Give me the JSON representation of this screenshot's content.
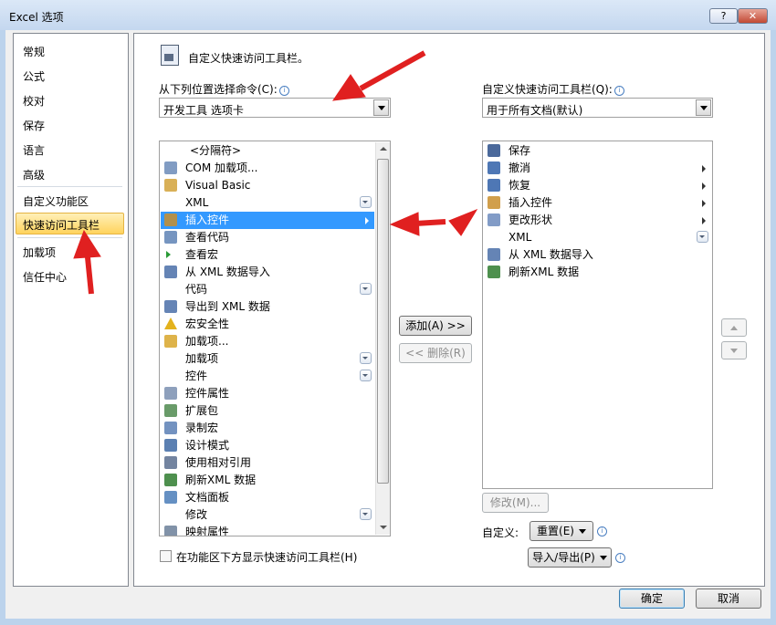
{
  "window": {
    "title": "Excel 选项",
    "help": "?",
    "close": "✕"
  },
  "nav": {
    "items": [
      "常规",
      "公式",
      "校对",
      "保存",
      "语言",
      "高级",
      "自定义功能区",
      "快速访问工具栏",
      "加载项",
      "信任中心"
    ],
    "selected": "快速访问工具栏"
  },
  "header": {
    "text": "自定义快速访问工具栏。"
  },
  "choose": {
    "label": "从下列位置选择命令(C):",
    "value": "开发工具 选项卡"
  },
  "customize": {
    "label": "自定义快速访问工具栏(Q):",
    "value": "用于所有文档(默认)"
  },
  "commands": [
    {
      "label": "<分隔符>",
      "icon": ""
    },
    {
      "label": "COM 加载项...",
      "icon": "com-addin-icon"
    },
    {
      "label": "Visual Basic",
      "icon": "visual-basic-icon"
    },
    {
      "label": "XML",
      "icon": "",
      "expand": true
    },
    {
      "label": "插入控件",
      "icon": "insert-control-icon",
      "submenu": true,
      "selected": true
    },
    {
      "label": "查看代码",
      "icon": "view-code-icon"
    },
    {
      "label": "查看宏",
      "icon": "play-icon"
    },
    {
      "label": "从 XML 数据导入",
      "icon": "xml-import-icon"
    },
    {
      "label": "代码",
      "icon": "",
      "expand": true
    },
    {
      "label": "导出到 XML 数据",
      "icon": "xml-export-icon"
    },
    {
      "label": "宏安全性",
      "icon": "warning-icon"
    },
    {
      "label": "加载项...",
      "icon": "addin-icon"
    },
    {
      "label": "加载项",
      "icon": "",
      "expand": true
    },
    {
      "label": "控件",
      "icon": "",
      "expand": true
    },
    {
      "label": "控件属性",
      "icon": "properties-icon"
    },
    {
      "label": "扩展包",
      "icon": "expansion-pack-icon"
    },
    {
      "label": "录制宏",
      "icon": "record-macro-icon"
    },
    {
      "label": "设计模式",
      "icon": "design-mode-icon"
    },
    {
      "label": "使用相对引用",
      "icon": "relative-ref-icon"
    },
    {
      "label": "刷新XML 数据",
      "icon": "refresh-xml-icon"
    },
    {
      "label": "文档面板",
      "icon": "document-panel-icon"
    },
    {
      "label": "修改",
      "icon": "",
      "expand": true
    },
    {
      "label": "映射属性",
      "icon": "map-properties-icon"
    }
  ],
  "toolbar_items": [
    {
      "label": "保存",
      "icon": "save-icon"
    },
    {
      "label": "撤消",
      "icon": "undo-icon",
      "submenu": true
    },
    {
      "label": "恢复",
      "icon": "redo-icon",
      "submenu": true
    },
    {
      "label": "插入控件",
      "icon": "insert-control-icon",
      "submenu": true
    },
    {
      "label": "更改形状",
      "icon": "change-shape-icon",
      "submenu": true
    },
    {
      "label": "XML",
      "icon": "",
      "expand": true
    },
    {
      "label": "从 XML 数据导入",
      "icon": "xml-import-icon"
    },
    {
      "label": "刷新XML 数据",
      "icon": "refresh-xml-icon"
    }
  ],
  "buttons": {
    "add": "添加(A) >>",
    "remove": "<< 删除(R)",
    "modify": "修改(M)...",
    "customize_label": "自定义:",
    "reset": "重置(E)",
    "import_export": "导入/导出(P)",
    "ok": "确定",
    "cancel": "取消"
  },
  "checkbox": {
    "label": "在功能区下方显示快速访问工具栏(H)",
    "checked": false
  },
  "colors": {
    "selection": "#3399ff",
    "nav_highlight": "#ffd35d",
    "arrow": "#e02020"
  }
}
